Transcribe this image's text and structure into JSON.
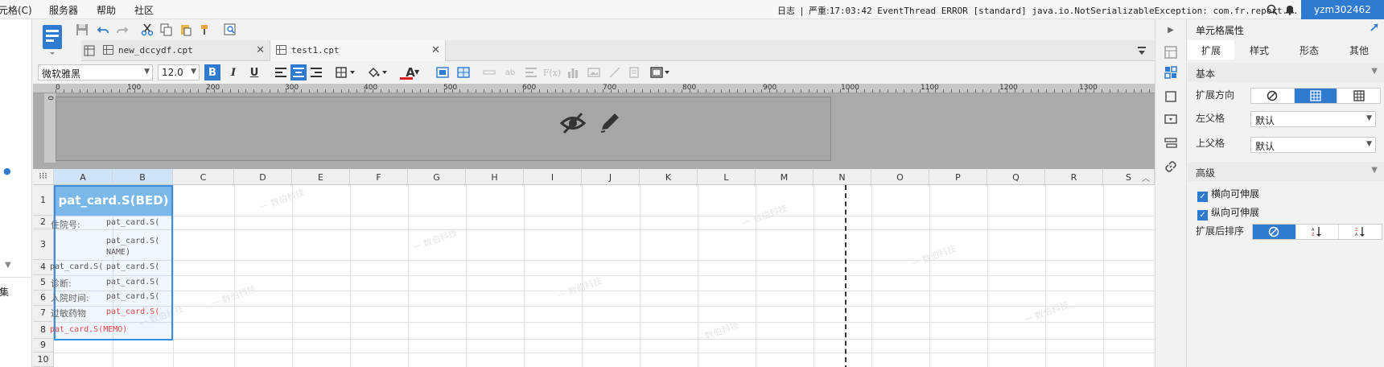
{
  "menubar": {
    "app_fragment": "元格(C)",
    "items": [
      "服务器",
      "帮助",
      "社区"
    ],
    "log_label": "日志",
    "log_sep": "|",
    "log_level": "严重:",
    "log_message": "17:03:42 EventThread ERROR [standard] java.io.NotSerializableException: com.fr.report...",
    "user": "yzm302462"
  },
  "tabs": [
    {
      "label": "new_dccydf.cpt"
    },
    {
      "label": "test1.cpt"
    }
  ],
  "format": {
    "font_family": "微软雅黑",
    "font_size": "12.0",
    "bold": "B",
    "italic": "I",
    "underline": "U",
    "font_color_glyph": "A",
    "font_color": "#e02020"
  },
  "ruler": {
    "labels": [
      "0",
      "100",
      "200",
      "300",
      "400",
      "500",
      "600",
      "700",
      "800",
      "900",
      "1000",
      "1100",
      "1200",
      "1300"
    ],
    "v_label": "0"
  },
  "grid": {
    "columns": [
      "A",
      "B",
      "C",
      "D",
      "E",
      "F",
      "G",
      "H",
      "I",
      "J",
      "K",
      "L",
      "M",
      "N",
      "O",
      "P",
      "Q",
      "R",
      "S"
    ],
    "rows": [
      "1",
      "2",
      "3",
      "4",
      "5",
      "6",
      "7",
      "8",
      "9",
      "10"
    ],
    "cells": {
      "a1": "pat_card.S(BED)",
      "a2": "住院号:",
      "b2": "pat_card.S(",
      "b3_line1": "pat_card.S(",
      "b3_line2": "NAME)",
      "a4": "pat_card.S(",
      "b4": "pat_card.S(",
      "a5": "诊断:",
      "b5": "pat_card.S(",
      "a6": "入院时间:",
      "b6": "pat_card.S(",
      "a7": "过敏药物",
      "b7": "pat_card.S(",
      "a8": "pat_card.S(MEMO)"
    },
    "watermark": "一 数伯科技"
  },
  "leftstrip": {
    "label": "集"
  },
  "panel": {
    "title": "单元格属性",
    "tabs": [
      "扩展",
      "样式",
      "形态",
      "其他"
    ],
    "basic_section": "基本",
    "expand_direction_label": "扩展方向",
    "left_parent_label": "左父格",
    "left_parent_value": "默认",
    "top_parent_label": "上父格",
    "top_parent_value": "默认",
    "advanced_section": "高级",
    "h_expand_label": "横向可伸展",
    "v_expand_label": "纵向可伸展",
    "sort_label": "扩展后排序",
    "check_glyph": "✓"
  },
  "colors": {
    "accent": "#2f7bd1",
    "selection": "#3b8de0",
    "merged_cell": "#7bb8ea",
    "error_text": "#e04848"
  }
}
